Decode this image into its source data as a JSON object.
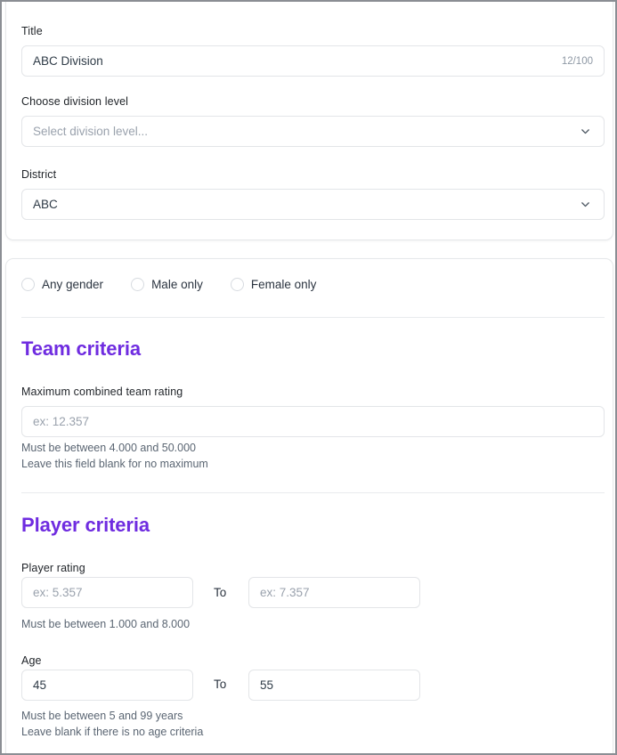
{
  "form": {
    "title_field": {
      "label": "Title",
      "value": "ABC Division",
      "counter": "12/100"
    },
    "division_level_field": {
      "label": "Choose division level",
      "placeholder": "Select division level...",
      "chevron_icon": "chevron-down-icon"
    },
    "district_field": {
      "label": "District",
      "value": "ABC",
      "chevron_icon": "chevron-down-icon"
    },
    "gender_options": [
      {
        "label": "Any gender",
        "selected": false
      },
      {
        "label": "Male only",
        "selected": false
      },
      {
        "label": "Female only",
        "selected": false
      }
    ],
    "team_criteria": {
      "heading": "Team criteria",
      "max_rating": {
        "label": "Maximum combined team rating",
        "placeholder": "ex: 12.357",
        "value": "",
        "helper_line1": "Must be between 4.000 and 50.000",
        "helper_line2": "Leave this field blank for no maximum"
      }
    },
    "player_criteria": {
      "heading": "Player criteria",
      "player_rating": {
        "label": "Player rating",
        "from_placeholder": "ex: 5.357",
        "from_value": "",
        "to_label": "To",
        "to_placeholder": "ex: 7.357",
        "to_value": "",
        "helper_line1": "Must be between 1.000 and 8.000"
      },
      "age": {
        "label": "Age",
        "from_value": "45",
        "to_label": "To",
        "to_value": "55",
        "helper_line1": "Must be between 5 and 99 years",
        "helper_line2": "Leave blank if there is no age criteria"
      }
    }
  },
  "colors": {
    "accent_purple": "#6f2ce0",
    "label_dark": "#1f2328",
    "helper_gray": "#5b6673",
    "placeholder_gray": "#9aa2ad",
    "border_gray": "#e3e5e8"
  }
}
